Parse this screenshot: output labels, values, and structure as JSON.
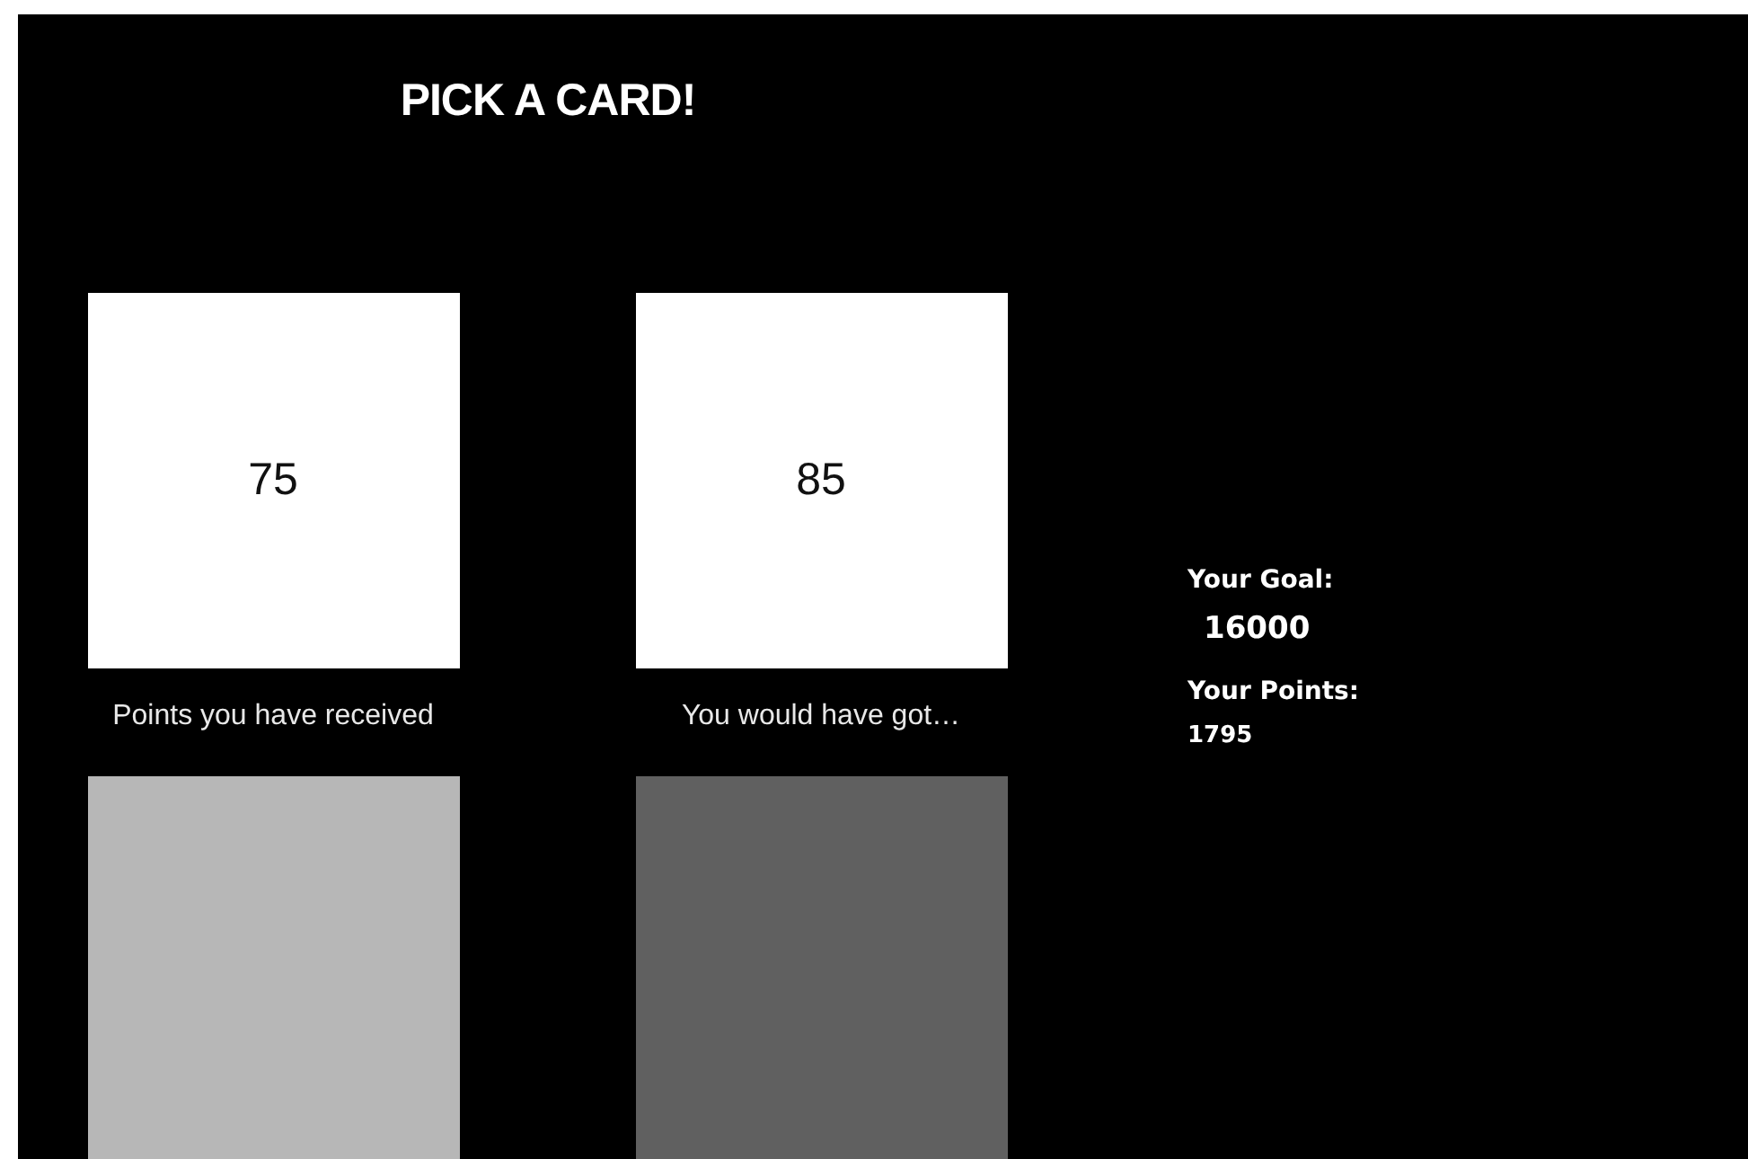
{
  "title": "PICK A CARD!",
  "columns": [
    {
      "value": "75",
      "caption": "Points you have received",
      "color": "#b7b7b7"
    },
    {
      "value": "85",
      "caption": "You would have got…",
      "color": "#606060"
    }
  ],
  "goal": {
    "label": "Your Goal:",
    "value": "16000"
  },
  "points": {
    "label": "Your Points:",
    "value": "1795"
  }
}
